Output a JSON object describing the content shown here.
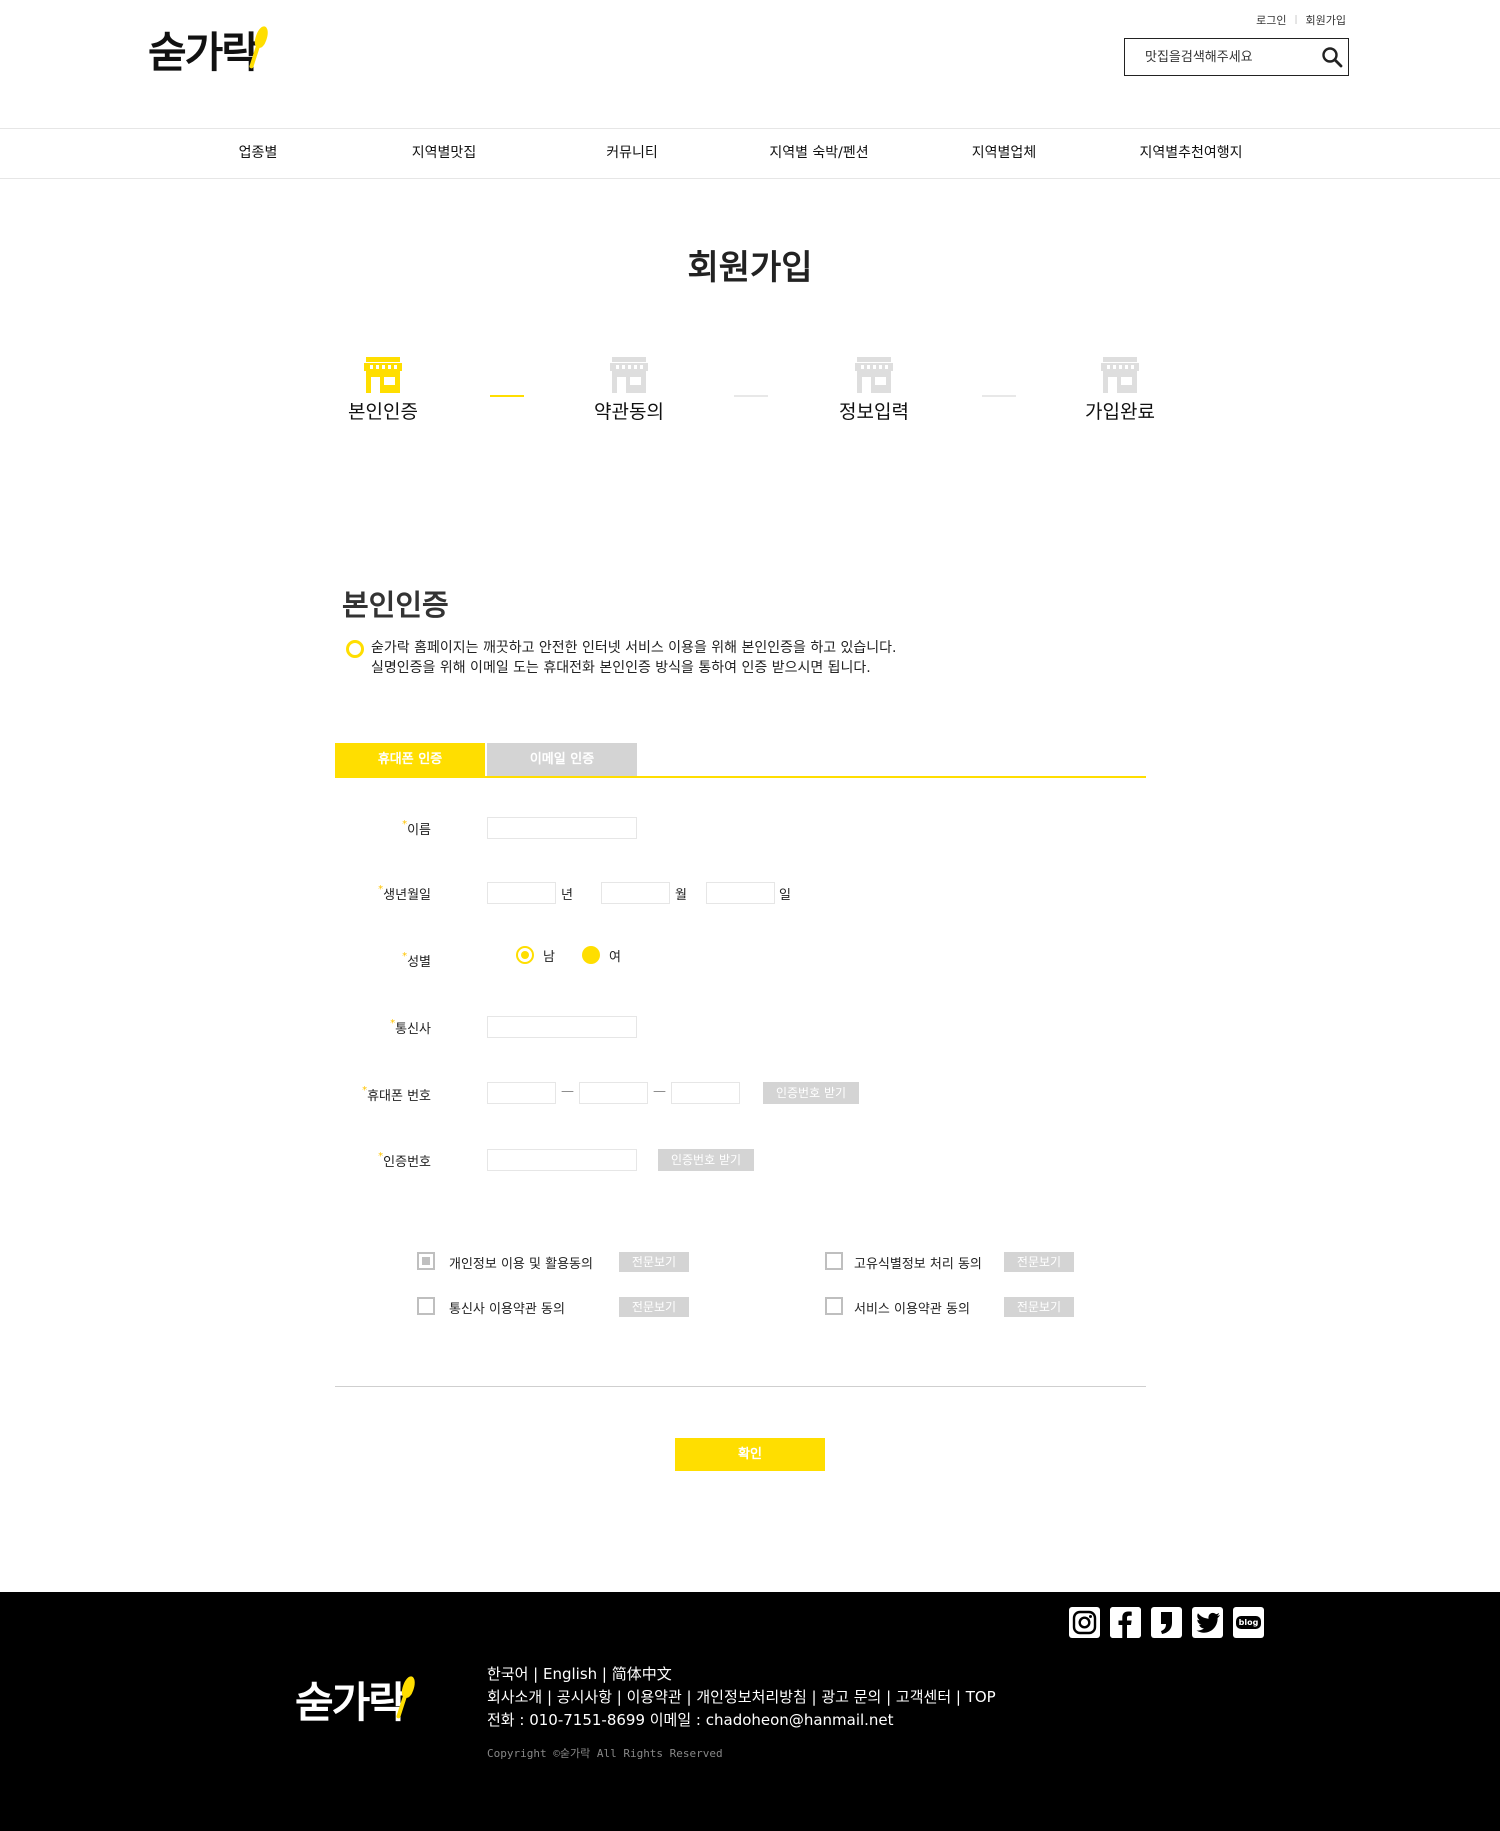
{
  "header": {
    "logo_text": "숟가락",
    "top_links": {
      "login": "로그인",
      "signup": "회원가입"
    },
    "search_placeholder": "맛집을검색해주세요"
  },
  "gnb": [
    "업종별",
    "지역별맛집",
    "커뮤니티",
    "지역별 숙박/펜션",
    "지역별업체",
    "지역별추천여행지"
  ],
  "page_title": "회원가입",
  "steps": [
    {
      "label": "본인인증",
      "active": true
    },
    {
      "label": "약관동의",
      "active": false
    },
    {
      "label": "정보입력",
      "active": false
    },
    {
      "label": "가입완료",
      "active": false
    }
  ],
  "section": {
    "title": "본인인증",
    "notice_line1": "숟가락 홈페이지는 깨끗하고 안전한 인터넷 서비스 이용을 위해 본인인증을 하고 있습니다.",
    "notice_line2": "실명인증을 위해 이메일 도는 휴대전화 본인인증 방식을 통하여 인증 받으시면 됩니다."
  },
  "tabs": {
    "phone": "휴대폰 인증",
    "email": "이메일 인증"
  },
  "form": {
    "required_mark": "*",
    "name_label": "이름",
    "birth_label": "생년월일",
    "year_unit": "년",
    "month_unit": "월",
    "day_unit": "일",
    "gender_label": "성별",
    "gender_male": "남",
    "gender_female": "여",
    "carrier_label": "통신사",
    "phone_label": "휴대폰 번호",
    "phone_dash": "—",
    "get_code_btn": "인증번호 받기",
    "code_label": "인증번호",
    "code_btn": "인증번호 받기"
  },
  "agreements": [
    {
      "label": "개인정보 이용 및 활용동의",
      "checked": true
    },
    {
      "label": "고유식별정보 처리 동의",
      "checked": false
    },
    {
      "label": "통신사 이용약관 동의",
      "checked": false
    },
    {
      "label": "서비스 이용약관 동의",
      "checked": false
    }
  ],
  "view_full_btn": "전문보기",
  "confirm_btn": "확인",
  "footer": {
    "logo_text": "숟가락",
    "languages": "한국어  | English  | 简体中文",
    "links": "회사소개 | 공시사항 | 이용약관 | 개인정보처리방침 | 광고 문의 | 고객센터 | TOP",
    "contact": "전화 : 010-7151-8699  이메일 : chadoheon@hanmail.net",
    "copyright": "Copyright ©숟가락  All Rights Reserved",
    "social": [
      "instagram-icon",
      "facebook-icon",
      "kakaostory-icon",
      "twitter-icon",
      "blog-icon"
    ],
    "blog_text": "blog"
  },
  "colors": {
    "accent": "#ffde00",
    "muted_gray": "#d4d4d4",
    "footer_bg": "#000000"
  }
}
